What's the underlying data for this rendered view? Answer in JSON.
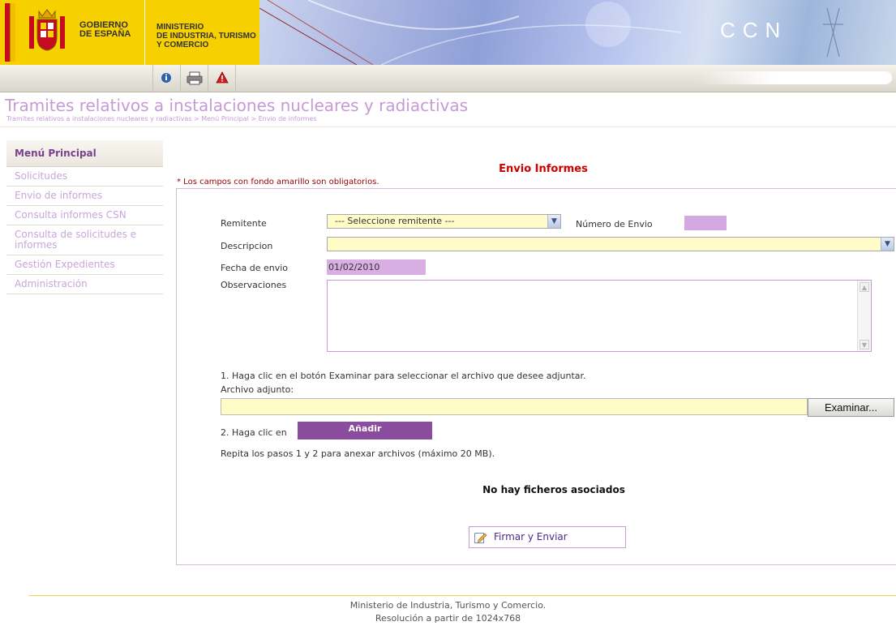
{
  "header": {
    "gov_line1": "GOBIERNO",
    "gov_line2": "DE ESPAÑA",
    "ministry_line1": "MINISTERIO",
    "ministry_line2": "DE INDUSTRIA, TURISMO",
    "ministry_line3": "Y COMERCIO",
    "brand": "CCN",
    "toolbar_icons": [
      "info-icon",
      "print-icon",
      "alert-icon"
    ]
  },
  "page": {
    "title": "Tramites relativos a instalaciones nucleares y radiactivas",
    "breadcrumb": "Tramites relativos a instalaciones nucleares y radiactivas > Menú Principal > Envio de informes"
  },
  "sidebar": {
    "heading": "Menú Principal",
    "items": [
      {
        "label": "Solicitudes"
      },
      {
        "label": "Envio de informes"
      },
      {
        "label": "Consulta informes CSN"
      },
      {
        "label": "Consulta de solicitudes e informes"
      },
      {
        "label": "Gestión Expedientes"
      },
      {
        "label": "Administración"
      }
    ]
  },
  "form": {
    "title": "Envio Informes",
    "required_note": "* Los campos con fondo amarillo son obligatorios.",
    "remitente_label": "Remitente",
    "remitente_value": "--- Seleccione remitente ---",
    "numero_label": "Número de Envio",
    "numero_value": "",
    "descripcion_label": "Descripcion",
    "descripcion_value": "",
    "fecha_label": "Fecha de envio",
    "fecha_value": "01/02/2010",
    "observaciones_label": "Observaciones",
    "step1_text": "1. Haga clic en el botón Examinar para seleccionar el archivo que desee adjuntar.",
    "archivo_label": "Archivo adjunto:",
    "browse_label": "Examinar...",
    "step2_text": "2. Haga clic en",
    "add_label": "Añadir",
    "repeat_text": "Repita los pasos 1 y 2 para anexar archivos (máximo 20 MB).",
    "no_files": "No hay ficheros asociados",
    "sign_label": "Firmar y Enviar"
  },
  "footer": {
    "line1": "Ministerio de Industria, Turismo y Comercio.",
    "line2": "Resolución a partir de 1024x768"
  },
  "colors": {
    "accent_purple": "#8a4c9d",
    "title_lilac": "#c69ad6",
    "required_yellow": "#fffcc8",
    "gov_yellow": "#f7d000",
    "form_title_red": "#cc0000"
  }
}
